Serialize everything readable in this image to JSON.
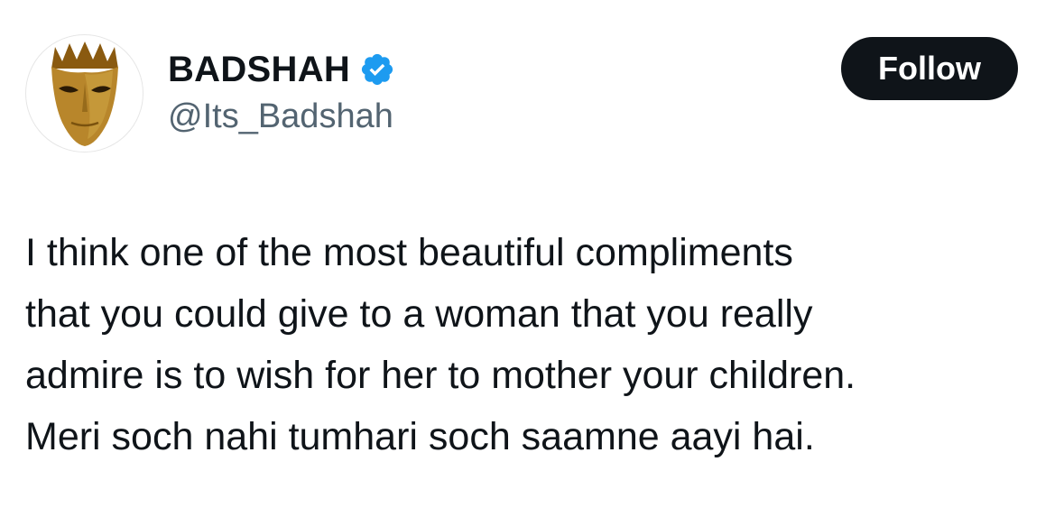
{
  "author": {
    "display_name": "BADSHAH",
    "handle": "@Its_Badshah",
    "verified": true,
    "avatar_icon": "gold-mask-crown-icon",
    "verified_icon": "verified-badge-icon"
  },
  "actions": {
    "follow_label": "Follow"
  },
  "tweet": {
    "lines": [
      "I think one of the most beautiful compliments",
      "that you could give to a woman that you really",
      "admire is to wish for her to mother your children.",
      "Meri soch nahi tumhari soch saamne aayi hai."
    ]
  },
  "colors": {
    "text_primary": "#0f1419",
    "text_secondary": "#536471",
    "verified_blue": "#1d9bf0",
    "button_bg": "#0f1419",
    "avatar_gold": "#b8862b"
  }
}
